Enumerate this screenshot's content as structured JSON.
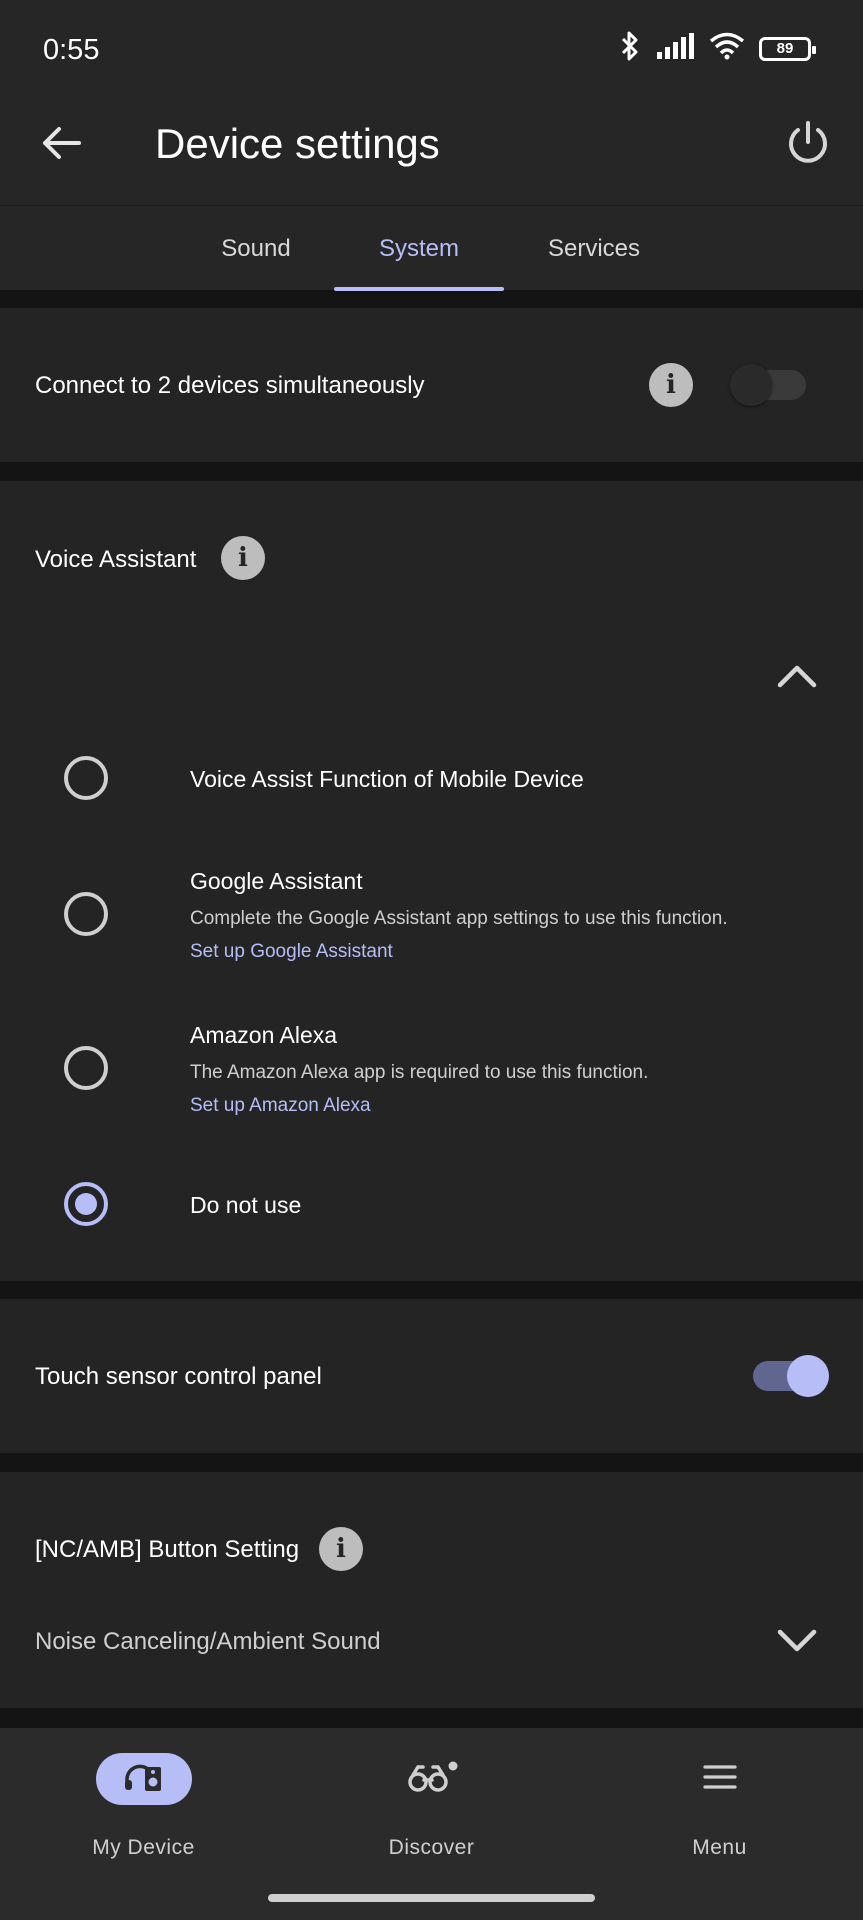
{
  "status_bar": {
    "time": "0:55",
    "battery": "89",
    "icons": [
      "bluetooth-icon",
      "signal-icon",
      "wifi-icon",
      "battery-icon"
    ]
  },
  "app_bar": {
    "title": "Device settings",
    "back_icon": "arrow-left-icon",
    "power_icon": "power-icon"
  },
  "tabs": [
    {
      "label": "Sound",
      "active": false
    },
    {
      "label": "System",
      "active": true
    },
    {
      "label": "Services",
      "active": false
    }
  ],
  "connect_two": {
    "label": "Connect to 2 devices simultaneously",
    "enabled": false
  },
  "voice_assistant": {
    "label": "Voice Assistant",
    "options": [
      {
        "title": "Voice Assist Function of Mobile Device",
        "description": "",
        "link": "",
        "selected": false
      },
      {
        "title": "Google Assistant",
        "description": "Complete the Google Assistant app settings to use this function.",
        "link": "Set up Google Assistant",
        "selected": false
      },
      {
        "title": "Amazon Alexa",
        "description": "The Amazon Alexa app is required to use this function.",
        "link": "Set up Amazon Alexa",
        "selected": false
      },
      {
        "title": "Do not use",
        "description": "",
        "link": "",
        "selected": true
      }
    ]
  },
  "touch_sensor": {
    "label": "Touch sensor control panel",
    "enabled": true
  },
  "nc_amb": {
    "label": "[NC/AMB] Button Setting",
    "value": "Noise Canceling/Ambient Sound"
  },
  "bottom_nav": [
    {
      "label": "My Device",
      "icon": "headphones-speaker-icon",
      "active": true
    },
    {
      "label": "Discover",
      "icon": "binoculars-icon",
      "active": false
    },
    {
      "label": "Menu",
      "icon": "menu-icon",
      "active": false
    }
  ],
  "colors": {
    "accent": "#b6bdf7",
    "background": "#141414",
    "surface": "#242424"
  }
}
